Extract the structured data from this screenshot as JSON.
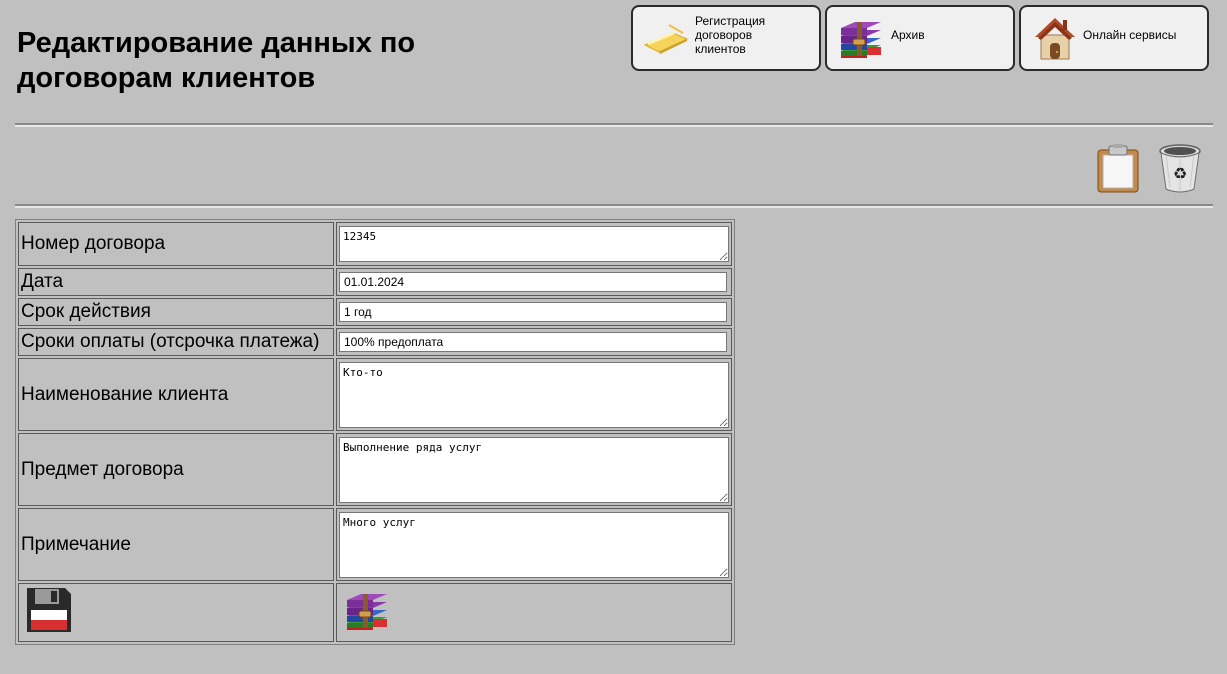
{
  "page": {
    "title": "Редактирование данных по договорам клиентов"
  },
  "nav": {
    "register": {
      "label": "Регистрация\nдоговоров\nклиентов",
      "icon": "contract-pen-icon"
    },
    "archive": {
      "label": "Архив",
      "icon": "archive-books-icon"
    },
    "online": {
      "label": "Онлайн сервисы",
      "icon": "house-icon"
    }
  },
  "toolbar": {
    "paste_icon": "clipboard-icon",
    "delete_icon": "recycle-bin-icon"
  },
  "form": {
    "contract_number": {
      "label": "Номер договора",
      "value": "12345"
    },
    "date": {
      "label": "Дата",
      "value": "01.01.2024"
    },
    "validity": {
      "label": "Срок действия",
      "value": "1 год"
    },
    "payment_terms": {
      "label": "Сроки оплаты (отсрочка платежа)",
      "value": "100% предоплата"
    },
    "client_name": {
      "label": "Наименование клиента",
      "value": "Кто-то"
    },
    "subject": {
      "label": "Предмет договора",
      "value": "Выполнение ряда услуг"
    },
    "note": {
      "label": "Примечание",
      "value": "Много услуг"
    }
  },
  "actions": {
    "save_icon": "floppy-disk-icon",
    "archive_icon": "archive-books-icon"
  }
}
